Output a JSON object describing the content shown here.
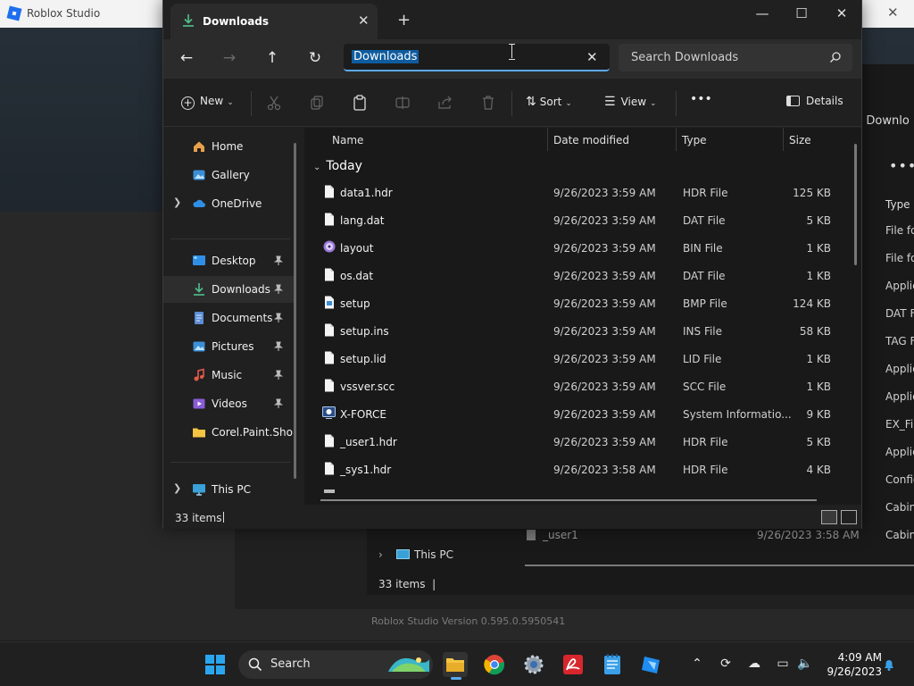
{
  "background_app": {
    "title": "Roblox Studio",
    "version_text": "Roblox Studio Version 0.595.0.5950541",
    "behind_window": {
      "search_fragment": "h Downlo",
      "type_header": "Type",
      "type_cells": [
        "File fo",
        "File fo",
        "Applic",
        "DAT F",
        "TAG F",
        "Applic",
        "Applic",
        "EX_Fi",
        "Applic",
        "Config",
        "Cabin",
        "Cabin"
      ],
      "this_pc": "This PC",
      "row_name": "_user1",
      "row_date": "9/26/2023 3:58 AM",
      "item_count": "33 items"
    }
  },
  "window": {
    "tab_title": "Downloads",
    "address_text": "Downloads",
    "search_placeholder": "Search Downloads"
  },
  "toolbar": {
    "new_label": "New",
    "sort_label": "Sort",
    "view_label": "View",
    "more_label": "•••",
    "details_label": "Details"
  },
  "sidebar": {
    "items": [
      {
        "label": "Home",
        "icon": "home-icon"
      },
      {
        "label": "Gallery",
        "icon": "gallery-icon"
      },
      {
        "label": "OneDrive",
        "icon": "cloud-icon"
      },
      {
        "label": "Desktop",
        "icon": "desktop-icon"
      },
      {
        "label": "Downloads",
        "icon": "download-icon"
      },
      {
        "label": "Documents",
        "icon": "documents-icon"
      },
      {
        "label": "Pictures",
        "icon": "pictures-icon"
      },
      {
        "label": "Music",
        "icon": "music-icon"
      },
      {
        "label": "Videos",
        "icon": "videos-icon"
      },
      {
        "label": "Corel.Paint.Shop",
        "icon": "folder-icon"
      },
      {
        "label": "This PC",
        "icon": "pc-icon"
      }
    ]
  },
  "columns": {
    "name": "Name",
    "date": "Date modified",
    "type": "Type",
    "size": "Size"
  },
  "group_label": "Today",
  "files": [
    {
      "name": "data1.hdr",
      "date": "9/26/2023 3:59 AM",
      "type": "HDR File",
      "size": "125 KB",
      "icon": "file-icon"
    },
    {
      "name": "lang.dat",
      "date": "9/26/2023 3:59 AM",
      "type": "DAT File",
      "size": "5 KB",
      "icon": "file-icon"
    },
    {
      "name": "layout",
      "date": "9/26/2023 3:59 AM",
      "type": "BIN File",
      "size": "1 KB",
      "icon": "disc-icon"
    },
    {
      "name": "os.dat",
      "date": "9/26/2023 3:59 AM",
      "type": "DAT File",
      "size": "1 KB",
      "icon": "file-icon"
    },
    {
      "name": "setup",
      "date": "9/26/2023 3:59 AM",
      "type": "BMP File",
      "size": "124 KB",
      "icon": "image-file-icon"
    },
    {
      "name": "setup.ins",
      "date": "9/26/2023 3:59 AM",
      "type": "INS File",
      "size": "58 KB",
      "icon": "file-icon"
    },
    {
      "name": "setup.lid",
      "date": "9/26/2023 3:59 AM",
      "type": "LID File",
      "size": "1 KB",
      "icon": "file-icon"
    },
    {
      "name": "vssver.scc",
      "date": "9/26/2023 3:59 AM",
      "type": "SCC File",
      "size": "1 KB",
      "icon": "file-icon"
    },
    {
      "name": "X-FORCE",
      "date": "9/26/2023 3:59 AM",
      "type": "System Informatio...",
      "size": "9 KB",
      "icon": "system-info-icon"
    },
    {
      "name": "_user1.hdr",
      "date": "9/26/2023 3:59 AM",
      "type": "HDR File",
      "size": "5 KB",
      "icon": "file-icon"
    },
    {
      "name": "_sys1.hdr",
      "date": "9/26/2023 3:58 AM",
      "type": "HDR File",
      "size": "4 KB",
      "icon": "file-icon"
    }
  ],
  "status": {
    "item_count": "33 items"
  },
  "taskbar": {
    "search_label": "Search",
    "time": "4:09 AM",
    "date": "9/26/2023"
  },
  "colors": {
    "accent": "#5aa9ec",
    "selection": "#0f5c9e",
    "folder": "#f5c542"
  }
}
